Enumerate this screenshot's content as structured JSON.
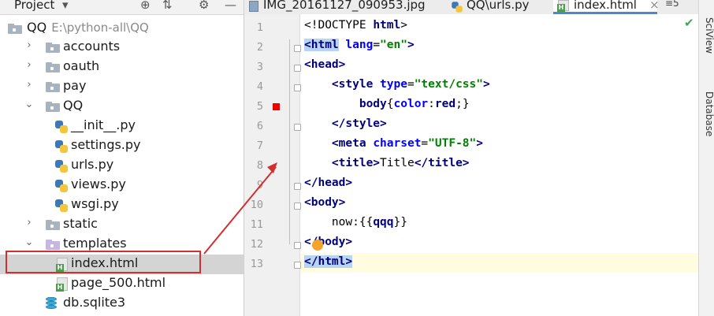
{
  "project_panel": {
    "title": "Project",
    "dropdown_icon": "chevron-down-icon",
    "icons": [
      "target-icon",
      "collapse-icon",
      "gear-icon",
      "hide-icon"
    ],
    "tree": [
      {
        "label": "QQ",
        "path": "E:\\python-all\\QQ",
        "type": "root-folder"
      },
      {
        "label": "accounts",
        "type": "folder",
        "expanded": false
      },
      {
        "label": "oauth",
        "type": "folder",
        "expanded": false
      },
      {
        "label": "pay",
        "type": "folder",
        "expanded": false
      },
      {
        "label": "QQ",
        "type": "folder",
        "expanded": true
      },
      {
        "label": "__init__.py",
        "type": "python-file"
      },
      {
        "label": "settings.py",
        "type": "python-file"
      },
      {
        "label": "urls.py",
        "type": "python-file"
      },
      {
        "label": "views.py",
        "type": "python-file"
      },
      {
        "label": "wsgi.py",
        "type": "python-file"
      },
      {
        "label": "static",
        "type": "folder",
        "expanded": false
      },
      {
        "label": "templates",
        "type": "folder",
        "expanded": true
      },
      {
        "label": "index.html",
        "type": "html-file",
        "selected": true
      },
      {
        "label": "page_500.html",
        "type": "html-file"
      },
      {
        "label": "db.sqlite3",
        "type": "database-file"
      }
    ]
  },
  "tabs": [
    {
      "label": "IMG_20161127_090953.jpg",
      "icon": "image-icon"
    },
    {
      "label": "QQ\\urls.py",
      "icon": "python-icon"
    },
    {
      "label": "index.html",
      "icon": "html-icon",
      "active": true
    }
  ],
  "tab_overflow": "≡5",
  "editor": {
    "lines": [
      {
        "n": "1",
        "tokens": [
          [
            "doc",
            "<!DOCTYPE "
          ],
          [
            "tag",
            "html"
          ],
          [
            "doc",
            ">"
          ]
        ]
      },
      {
        "n": "2",
        "tokens": [
          [
            "tag",
            "<html"
          ],
          [
            "txt",
            " "
          ],
          [
            "attr",
            "lang"
          ],
          [
            "txt",
            "="
          ],
          [
            "str",
            "\"en\""
          ],
          [
            "tag",
            ">"
          ]
        ]
      },
      {
        "n": "3",
        "tokens": [
          [
            "tag",
            "<head>"
          ]
        ]
      },
      {
        "n": "4",
        "tokens": [
          [
            "txt",
            "    "
          ],
          [
            "tag",
            "<style"
          ],
          [
            "txt",
            " "
          ],
          [
            "attr",
            "type"
          ],
          [
            "txt",
            "="
          ],
          [
            "str",
            "\"text/css\""
          ],
          [
            "tag",
            ">"
          ]
        ]
      },
      {
        "n": "5",
        "tokens": [
          [
            "txt",
            "        "
          ],
          [
            "sel",
            "body"
          ],
          [
            "txt",
            "{"
          ],
          [
            "prop",
            "color"
          ],
          [
            "txt",
            ":"
          ],
          [
            "val",
            "red"
          ],
          [
            "txt",
            ";}"
          ]
        ]
      },
      {
        "n": "6",
        "tokens": [
          [
            "txt",
            "    "
          ],
          [
            "tag",
            "</style>"
          ]
        ]
      },
      {
        "n": "7",
        "tokens": [
          [
            "txt",
            "    "
          ],
          [
            "tag",
            "<meta"
          ],
          [
            "txt",
            " "
          ],
          [
            "attr",
            "charset"
          ],
          [
            "txt",
            "="
          ],
          [
            "str",
            "\"UTF-8\""
          ],
          [
            "tag",
            ">"
          ]
        ]
      },
      {
        "n": "8",
        "tokens": [
          [
            "txt",
            "    "
          ],
          [
            "tag",
            "<title>"
          ],
          [
            "txt",
            "Title"
          ],
          [
            "tag",
            "</title>"
          ]
        ]
      },
      {
        "n": "9",
        "tokens": [
          [
            "tag",
            "</head>"
          ]
        ]
      },
      {
        "n": "10",
        "tokens": [
          [
            "tag",
            "<body>"
          ]
        ]
      },
      {
        "n": "11",
        "tokens": [
          [
            "txt",
            "    now:{{"
          ],
          [
            "tpl",
            "qqq"
          ],
          [
            "txt",
            "}}"
          ]
        ]
      },
      {
        "n": "12",
        "tokens": [
          [
            "tag",
            "</body>"
          ]
        ]
      },
      {
        "n": "13",
        "tokens": [
          [
            "tag",
            "</html>"
          ]
        ]
      }
    ]
  },
  "right_strip": {
    "items": [
      "SciView",
      "Database"
    ]
  },
  "colors": {
    "selection_box": "#d32f2f",
    "breakpoint": "#ee0000",
    "active_tab_underline": "#4a88c7"
  }
}
